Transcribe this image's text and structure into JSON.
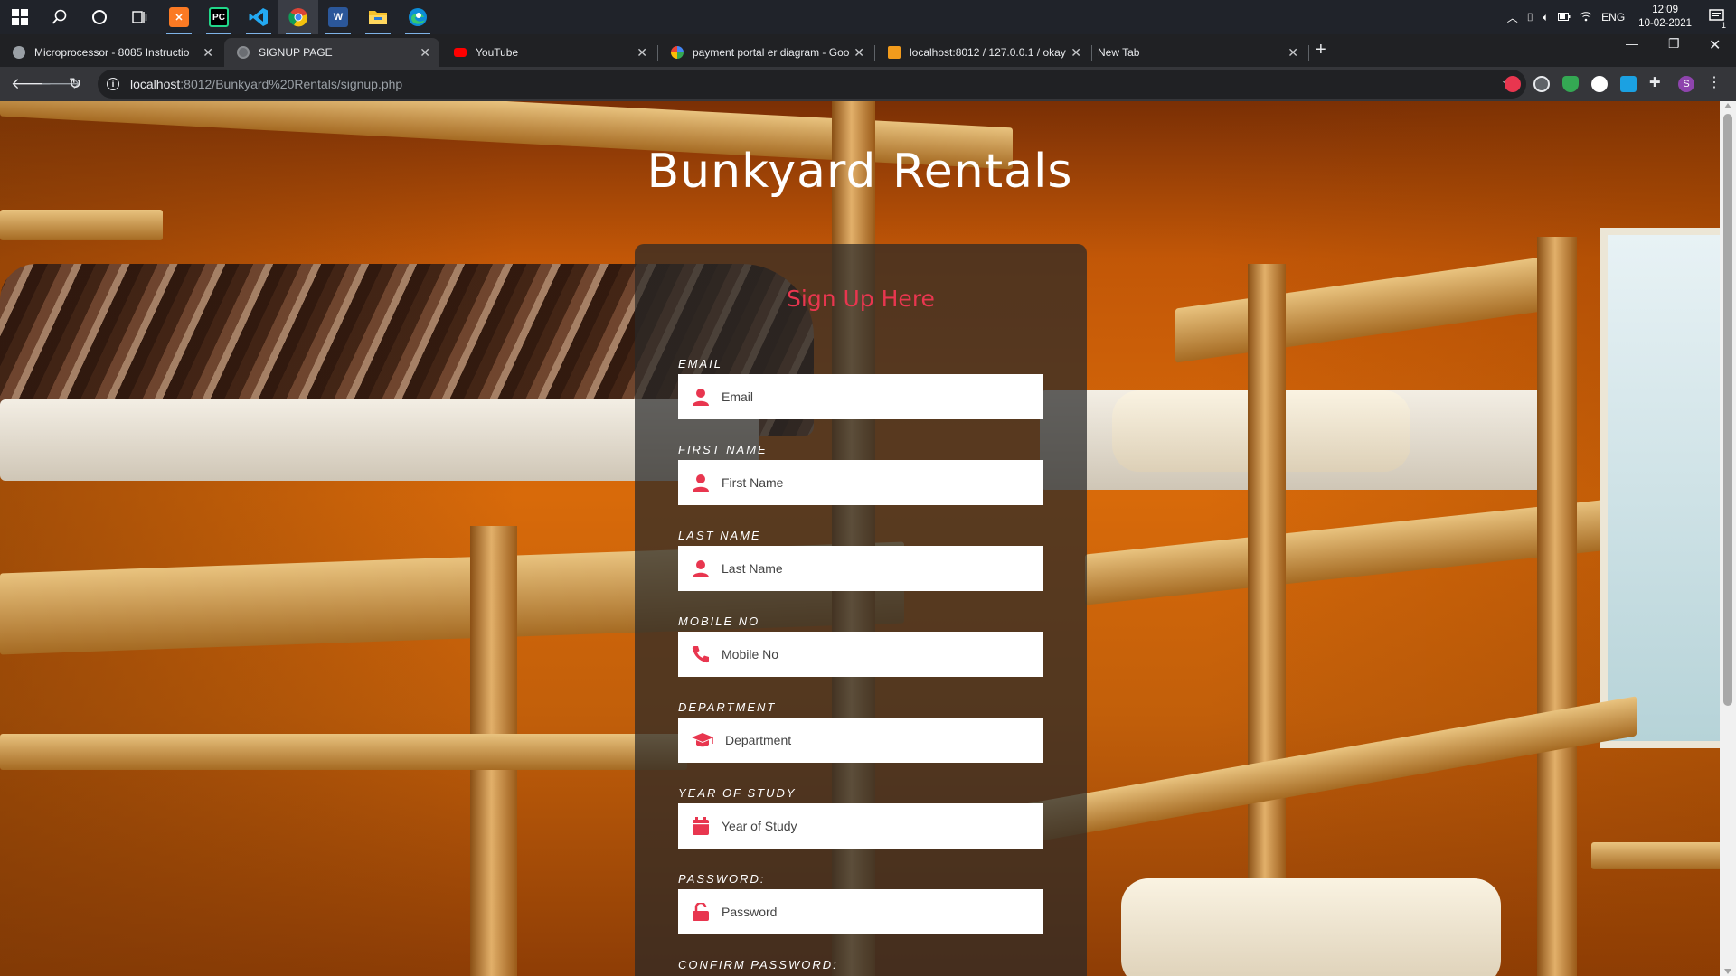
{
  "taskbar": {
    "apps": [
      {
        "name": "Windows Start",
        "icon": "windows-start-icon"
      },
      {
        "name": "Search",
        "icon": "search-icon"
      },
      {
        "name": "Cortana",
        "icon": "cortana-icon"
      },
      {
        "name": "Task View",
        "icon": "task-view-icon"
      },
      {
        "name": "XAMPP",
        "icon": "xampp-icon",
        "color": "#fb7a24"
      },
      {
        "name": "PyCharm",
        "icon": "pycharm-icon",
        "color": "#21d789"
      },
      {
        "name": "Visual Studio Code",
        "icon": "vscode-icon",
        "color": "#23a9f2"
      },
      {
        "name": "Google Chrome",
        "icon": "chrome-icon",
        "color": "#4285f4"
      },
      {
        "name": "Microsoft Word",
        "icon": "word-icon",
        "color": "#2b579a"
      },
      {
        "name": "File Explorer",
        "icon": "file-explorer-icon",
        "color": "#f8c22c"
      },
      {
        "name": "Microsoft Edge",
        "icon": "edge-icon",
        "color": "#0c8dd8"
      }
    ],
    "tray": {
      "language": "ENG",
      "time": "12:09",
      "date": "10-02-2021",
      "notification_count": "1"
    }
  },
  "browser": {
    "tabs": [
      {
        "title": "Microprocessor - 8085 Instructio",
        "favicon": "tutorialspoint-icon",
        "active": false
      },
      {
        "title": "SIGNUP PAGE",
        "favicon": "page-icon",
        "active": true
      },
      {
        "title": "YouTube",
        "favicon": "youtube-icon",
        "active": false
      },
      {
        "title": "payment portal er diagram - Goo",
        "favicon": "google-icon",
        "active": false
      },
      {
        "title": "localhost:8012 / 127.0.0.1 / okay",
        "favicon": "phpmyadmin-icon",
        "active": false
      },
      {
        "title": "New Tab",
        "favicon": "",
        "active": false
      }
    ],
    "url_host": "localhost",
    "url_rest": ":8012/Bunkyard%20Rentals/signup.php",
    "profile_initial": "S"
  },
  "page": {
    "site_title": "Bunkyard Rentals",
    "form_heading": "Sign Up Here",
    "accent_color": "#e8364f",
    "fields": [
      {
        "label": "EMAIL",
        "placeholder": "Email",
        "icon": "user-icon"
      },
      {
        "label": "FIRST NAME",
        "placeholder": "First Name",
        "icon": "user-icon"
      },
      {
        "label": "LAST NAME",
        "placeholder": "Last Name",
        "icon": "user-icon"
      },
      {
        "label": "MOBILE NO",
        "placeholder": "Mobile No",
        "icon": "phone-icon"
      },
      {
        "label": "DEPARTMENT",
        "placeholder": "Department",
        "icon": "graduation-cap-icon"
      },
      {
        "label": "YEAR OF STUDY",
        "placeholder": "Year of Study",
        "icon": "calendar-icon"
      },
      {
        "label": "PASSWORD:",
        "placeholder": "Password",
        "icon": "unlock-icon"
      },
      {
        "label": "CONFIRM PASSWORD:",
        "placeholder": "",
        "icon": ""
      }
    ]
  }
}
